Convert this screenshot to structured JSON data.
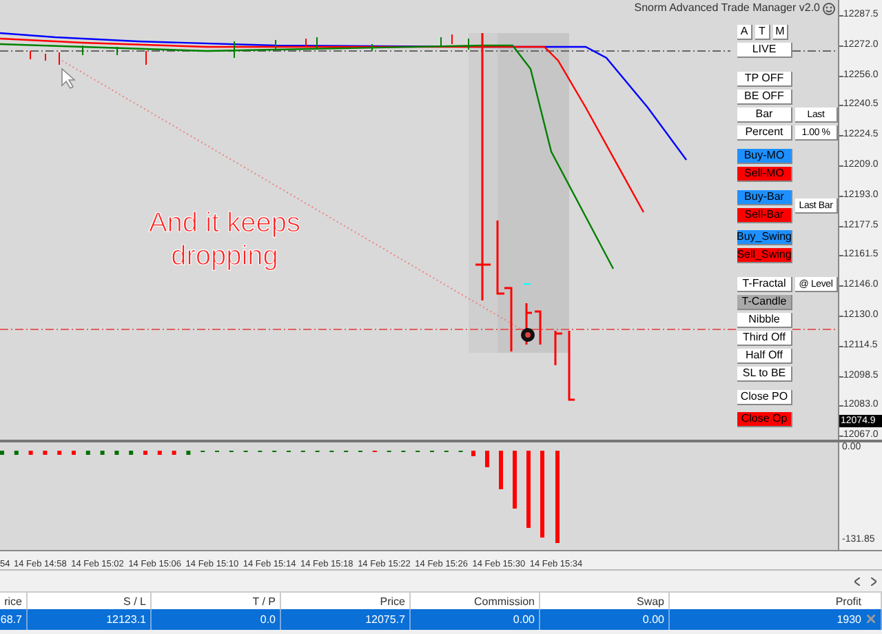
{
  "indicator_title": "Snorm Advanced Trade Manager v2.0",
  "annotation": [
    "And it keeps",
    "dropping"
  ],
  "price_axis": [
    "12287.5",
    "12272.0",
    "12256.0",
    "12240.5",
    "12224.5",
    "12209.0",
    "12193.0",
    "12177.5",
    "12161.5",
    "12146.0",
    "12130.0",
    "12114.5",
    "12098.5",
    "12083.0",
    "12067.0"
  ],
  "current_price": "12074.9",
  "oscillator_axis": [
    "0.00",
    "-131.85"
  ],
  "time_axis": [
    "54",
    "14 Feb 14:58",
    "14 Feb 15:02",
    "14 Feb 15:06",
    "14 Feb 15:10",
    "14 Feb 15:14",
    "14 Feb 15:18",
    "14 Feb 15:22",
    "14 Feb 15:26",
    "14 Feb 15:30",
    "14 Feb 15:34"
  ],
  "panel": [
    [
      [
        {
          "label": "A",
          "kind": "small"
        },
        {
          "label": "T",
          "kind": "small"
        },
        {
          "label": "M",
          "kind": "small"
        }
      ],
      [
        {
          "label": "LIVE",
          "kind": "white"
        }
      ]
    ],
    [
      [
        {
          "label": "TP OFF",
          "kind": "white"
        }
      ],
      [
        {
          "label": "BE OFF",
          "kind": "white"
        }
      ],
      [
        {
          "label": "Bar",
          "kind": "white"
        },
        {
          "label": "Last",
          "kind": "box"
        }
      ],
      [
        {
          "label": "Percent",
          "kind": "white"
        },
        {
          "label": "1.00 %",
          "kind": "box"
        }
      ]
    ],
    [
      [
        {
          "label": "Buy-MO",
          "kind": "blue"
        }
      ],
      [
        {
          "label": "Sell-MO",
          "kind": "red"
        }
      ]
    ],
    [
      [
        {
          "label": "Buy-Bar",
          "kind": "blue"
        },
        {
          "label": "Last Bar",
          "kind": "box"
        }
      ],
      [
        {
          "label": "Sell-Bar",
          "kind": "red"
        }
      ]
    ],
    [
      [
        {
          "label": "Buy_Swing",
          "kind": "blue"
        }
      ],
      [
        {
          "label": "Sell_Swing",
          "kind": "red"
        }
      ]
    ],
    [
      [
        {
          "label": "T-Fractal",
          "kind": "white"
        },
        {
          "label": "@ Level",
          "kind": "box"
        }
      ],
      [
        {
          "label": "T-Candle",
          "kind": "gray"
        }
      ],
      [
        {
          "label": "Nibble",
          "kind": "white"
        }
      ],
      [
        {
          "label": "Third Off",
          "kind": "white"
        }
      ],
      [
        {
          "label": "Half Off",
          "kind": "white"
        }
      ],
      [
        {
          "label": "SL to BE",
          "kind": "white"
        }
      ]
    ],
    [
      [
        {
          "label": "Close PO",
          "kind": "white"
        }
      ]
    ],
    [
      [
        {
          "label": "Close Op",
          "kind": "red"
        }
      ]
    ]
  ],
  "table": {
    "columns": [
      "rice",
      "S / L",
      "T / P",
      "Price",
      "Commission",
      "Swap",
      "Profit"
    ],
    "rows": [
      {
        "selected": true,
        "cells": [
          "68.7",
          "12123.1",
          "0.0",
          "12075.7",
          "0.00",
          "0.00",
          "1930"
        ]
      }
    ]
  }
}
